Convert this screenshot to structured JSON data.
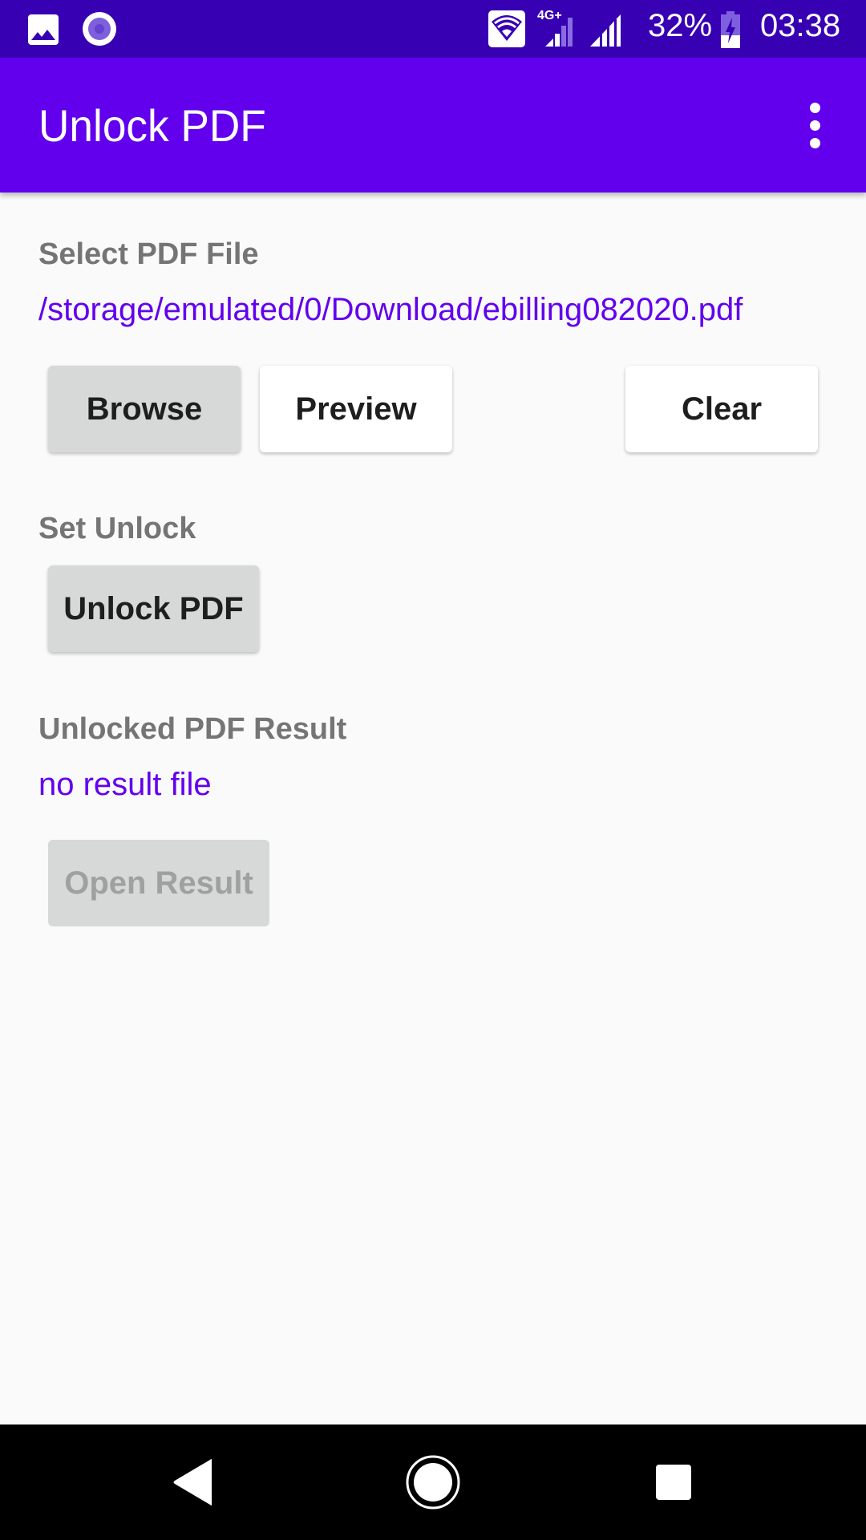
{
  "status_bar": {
    "left_icons": [
      "image-notification-icon",
      "circle-notification-icon"
    ],
    "right_icons": [
      "wifi-icon",
      "signal-4g-plus-icon",
      "signal-icon",
      "battery-charging-icon"
    ],
    "network_label": "4G+",
    "battery_percent": "32%",
    "time": "03:38",
    "colors": {
      "background": "#3700B3"
    }
  },
  "app_bar": {
    "title": "Unlock PDF",
    "overflow_icon": "more-vert-icon",
    "colors": {
      "background": "#6200EE"
    }
  },
  "select_section": {
    "label": "Select PDF File",
    "file_path": "/storage/emulated/0/Download/ebilling082020.pdf",
    "buttons": {
      "browse": "Browse",
      "preview": "Preview",
      "clear": "Clear"
    }
  },
  "unlock_section": {
    "label": "Set Unlock",
    "button": "Unlock PDF"
  },
  "result_section": {
    "label": "Unlocked PDF Result",
    "status": "no result file",
    "button": "Open Result",
    "button_enabled": false
  },
  "nav_bar": {
    "buttons": [
      "back-icon",
      "home-icon",
      "recents-icon"
    ]
  },
  "theme": {
    "accent": "#6200EE",
    "label_gray": "#757575",
    "background": "#FAFAFA"
  }
}
